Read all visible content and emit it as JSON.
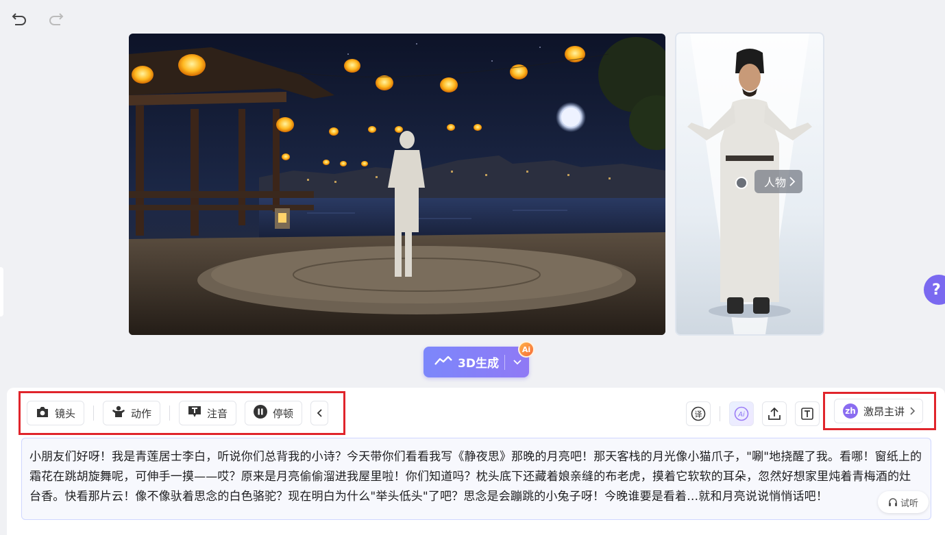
{
  "toolbar_top": {
    "undo_icon": "undo-icon",
    "redo_icon": "redo-icon"
  },
  "stage": {
    "description_icon": "scene-preview"
  },
  "character_card": {
    "button_label": "人物",
    "chevron": "›"
  },
  "generate": {
    "label": "3D生成",
    "badge": "Ai"
  },
  "help": {
    "label": "?"
  },
  "tools": [
    {
      "label": "镜头",
      "icon": "camera-icon"
    },
    {
      "label": "动作",
      "icon": "person-action-icon"
    },
    {
      "label": "注音",
      "icon": "text-t-icon"
    },
    {
      "label": "停顿",
      "icon": "pause-icon"
    }
  ],
  "right_tools": {
    "translate_icon": "translate-icon",
    "ai_icon": "ai-icon",
    "upload_icon": "upload-icon",
    "text_icon": "text-frame-icon"
  },
  "voice": {
    "badge": "zh",
    "label": "激昂主讲"
  },
  "script_text": "小朋友们好呀！我是青莲居士李白，听说你们总背我的小诗？今天带你们看看我写《静夜思》那晚的月亮吧！那天客栈的月光像小猫爪子，\"唰\"地挠醒了我。看哪！窗纸上的霜花在跳胡旋舞呢，可伸手一摸——哎？原来是月亮偷偷溜进我屋里啦！你们知道吗？枕头底下还藏着娘亲缝的布老虎，摸着它软软的耳朵，忽然好想家里炖着青梅酒的灶台香。快看那片云！像不像驮着思念的白色骆驼？现在明白为什么\"举头低头\"了吧？思念是会蹦跳的小兔子呀！今晚谁要是看着…就和月亮说说悄悄话吧！",
  "try_listen": {
    "label": "试听"
  }
}
